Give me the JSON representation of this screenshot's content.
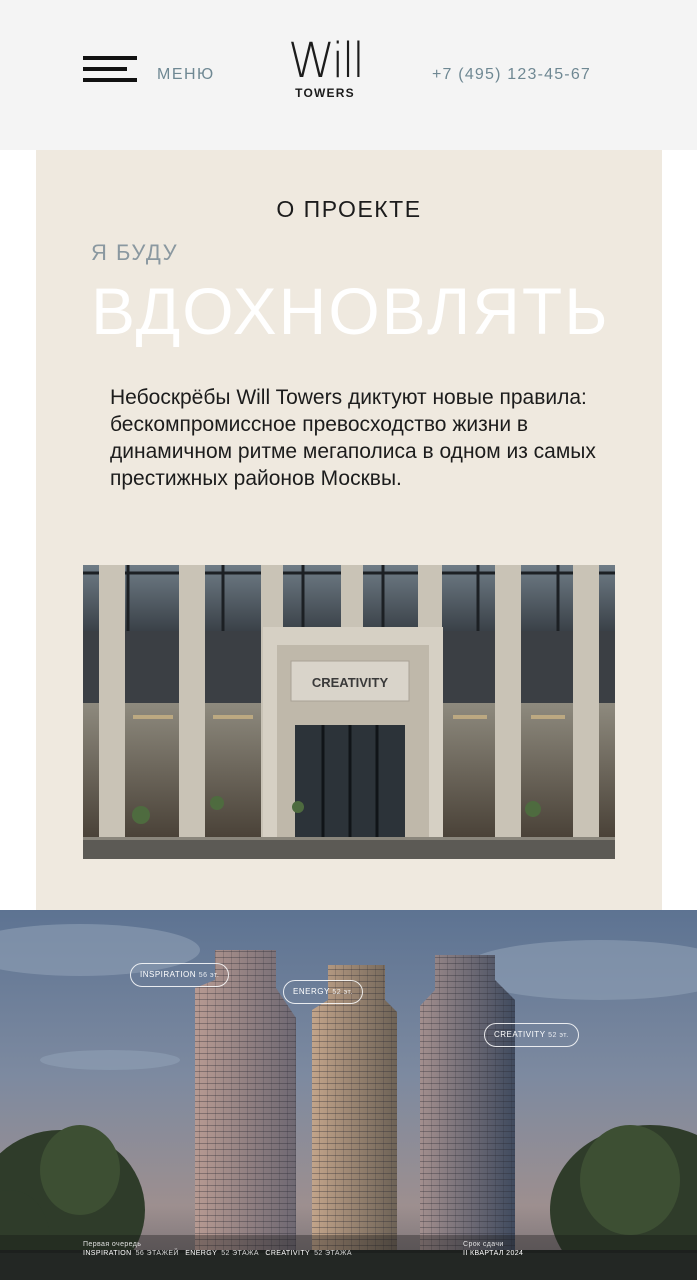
{
  "header": {
    "menu_label": "МЕНЮ",
    "logo_main": "Will",
    "logo_sub": "TOWERS",
    "phone": "+7 (495) 123-45-67"
  },
  "about": {
    "title": "О ПРОЕКТЕ",
    "tagline_small": "Я БУДУ",
    "tagline_big": "ВДОХНОВЛЯТЬ",
    "description": "Небоскрёбы Will Towers диктуют новые правила: бескомпромиссное превосходство жизни в динамичном ритме мегаполиса в одном из самых престижных районов Москвы.",
    "entrance_sign": "CREATIVITY"
  },
  "towers": {
    "labels": [
      {
        "name": "INSPIRATION",
        "floors": "56 эт."
      },
      {
        "name": "ENERGY",
        "floors": "52 эт."
      },
      {
        "name": "CREATIVITY",
        "floors": "52 эт."
      }
    ],
    "queue_caption": "Первая очередь",
    "queue_items": [
      {
        "name": "INSPIRATION",
        "floors": "56 ЭТАЖЕЙ"
      },
      {
        "name": "ENERGY",
        "floors": "52 ЭТАЖА"
      },
      {
        "name": "CREATIVITY",
        "floors": "52 ЭТАЖА"
      }
    ],
    "deadline_caption": "Срок сдачи",
    "deadline_value": "II КВАРТАЛ 2024"
  },
  "colors": {
    "header_bg": "#f4f4f4",
    "panel_bg": "#efe9df",
    "accent_grey_blue": "#6f8893",
    "text_dark": "#1c1c1c"
  },
  "icons": {
    "menu": "hamburger-icon"
  }
}
